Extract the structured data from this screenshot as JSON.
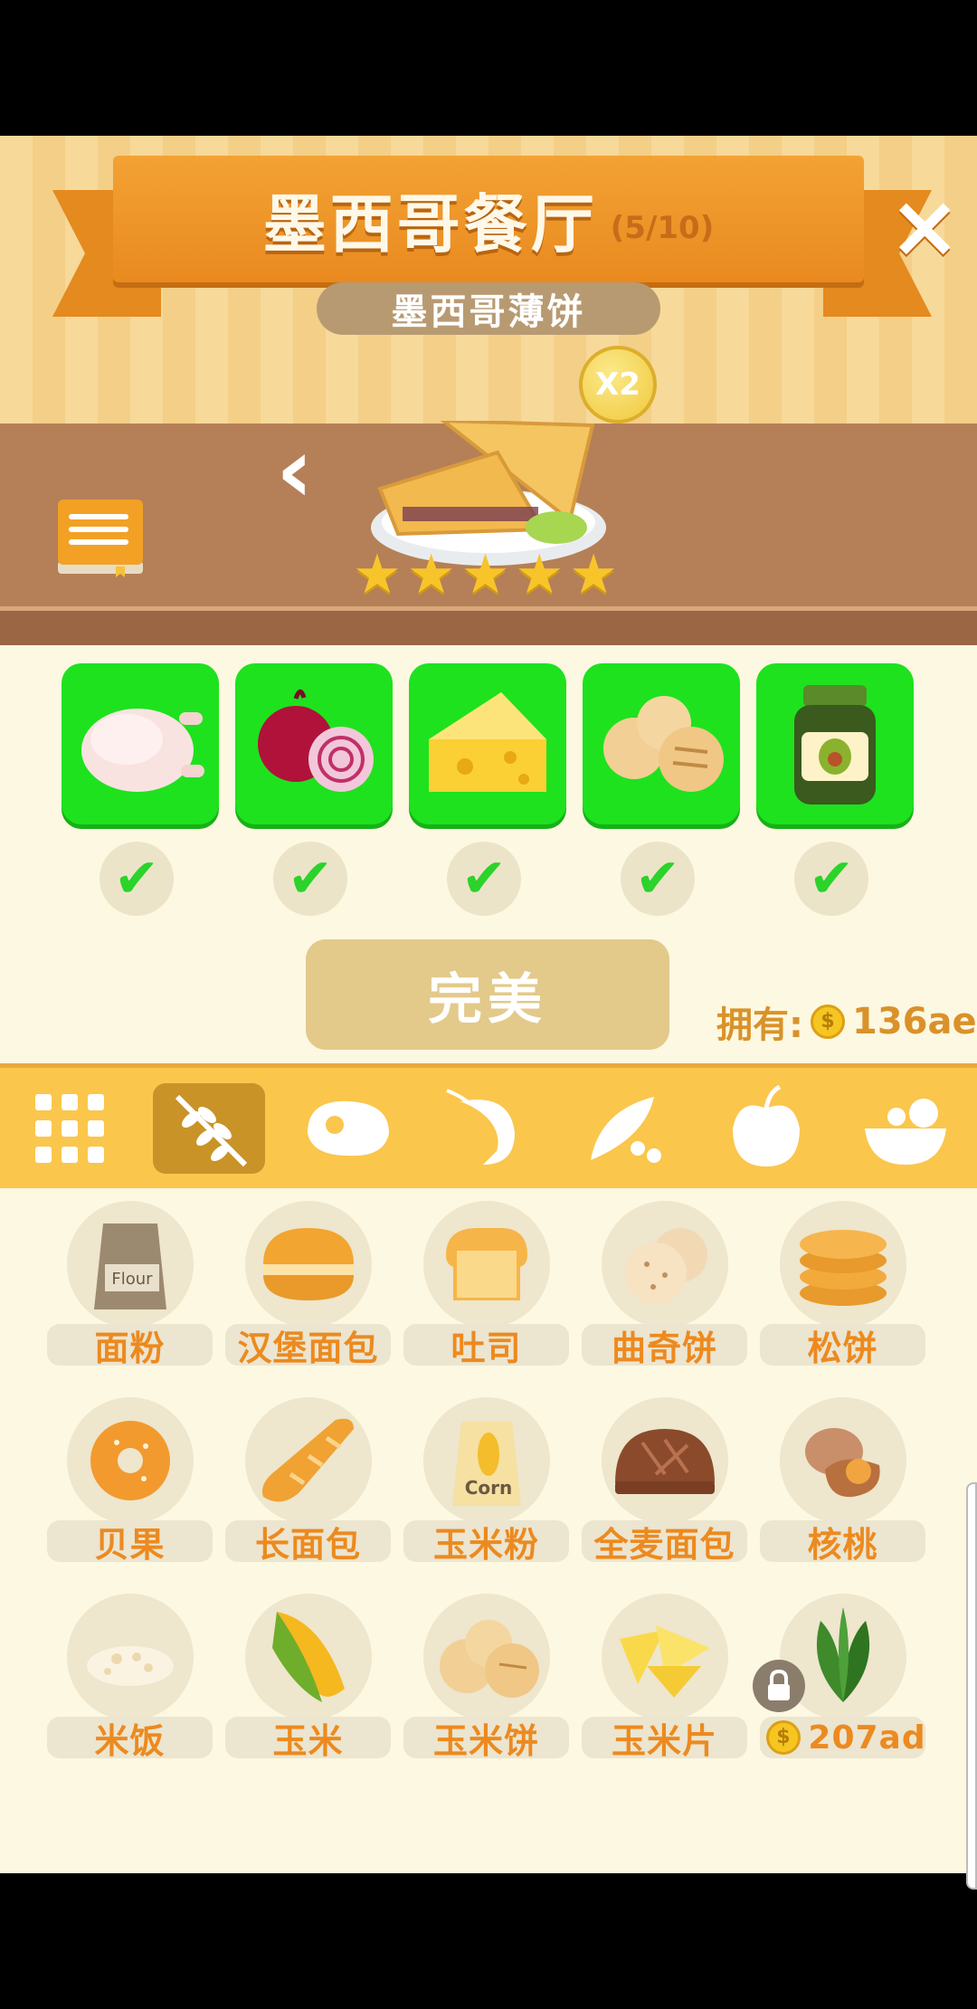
{
  "header": {
    "title": "墨西哥餐厅",
    "progress": "(5/10)",
    "subtitle": "墨西哥薄饼",
    "multiplier": "X2",
    "close_icon": "close-icon"
  },
  "dish": {
    "name_icon": "quesadilla-plate",
    "stars": 5
  },
  "ingredients": [
    {
      "icon": "chicken",
      "checked": true
    },
    {
      "icon": "onion",
      "checked": true
    },
    {
      "icon": "cheese",
      "checked": true
    },
    {
      "icon": "tortilla",
      "checked": true
    },
    {
      "icon": "avocado-jar",
      "checked": true
    }
  ],
  "perfect_button": "完美",
  "owned": {
    "label": "拥有:",
    "amount": "136ae",
    "coin_symbol": "$"
  },
  "categories": [
    {
      "icon": "grid-icon"
    },
    {
      "icon": "grain-icon",
      "active": true
    },
    {
      "icon": "meat-icon"
    },
    {
      "icon": "shrimp-icon"
    },
    {
      "icon": "peas-icon"
    },
    {
      "icon": "apple-icon"
    },
    {
      "icon": "salad-icon"
    }
  ],
  "items": [
    {
      "label": "面粉",
      "icon": "flour-bag"
    },
    {
      "label": "汉堡面包",
      "icon": "burger-bun"
    },
    {
      "label": "吐司",
      "icon": "toast"
    },
    {
      "label": "曲奇饼",
      "icon": "cookies"
    },
    {
      "label": "松饼",
      "icon": "pancakes"
    },
    {
      "label": "贝果",
      "icon": "bagel"
    },
    {
      "label": "长面包",
      "icon": "baguette"
    },
    {
      "label": "玉米粉",
      "icon": "corn-flour"
    },
    {
      "label": "全麦面包",
      "icon": "wholewheat-bread"
    },
    {
      "label": "核桃",
      "icon": "walnut"
    },
    {
      "label": "米饭",
      "icon": "rice"
    },
    {
      "label": "玉米",
      "icon": "corn"
    },
    {
      "label": "玉米饼",
      "icon": "tortilla"
    },
    {
      "label": "玉米片",
      "icon": "nachos"
    },
    {
      "label": "",
      "icon": "leaf",
      "locked": true,
      "price": "207ad"
    }
  ],
  "flour_text": "Flour",
  "corn_text": "Corn"
}
